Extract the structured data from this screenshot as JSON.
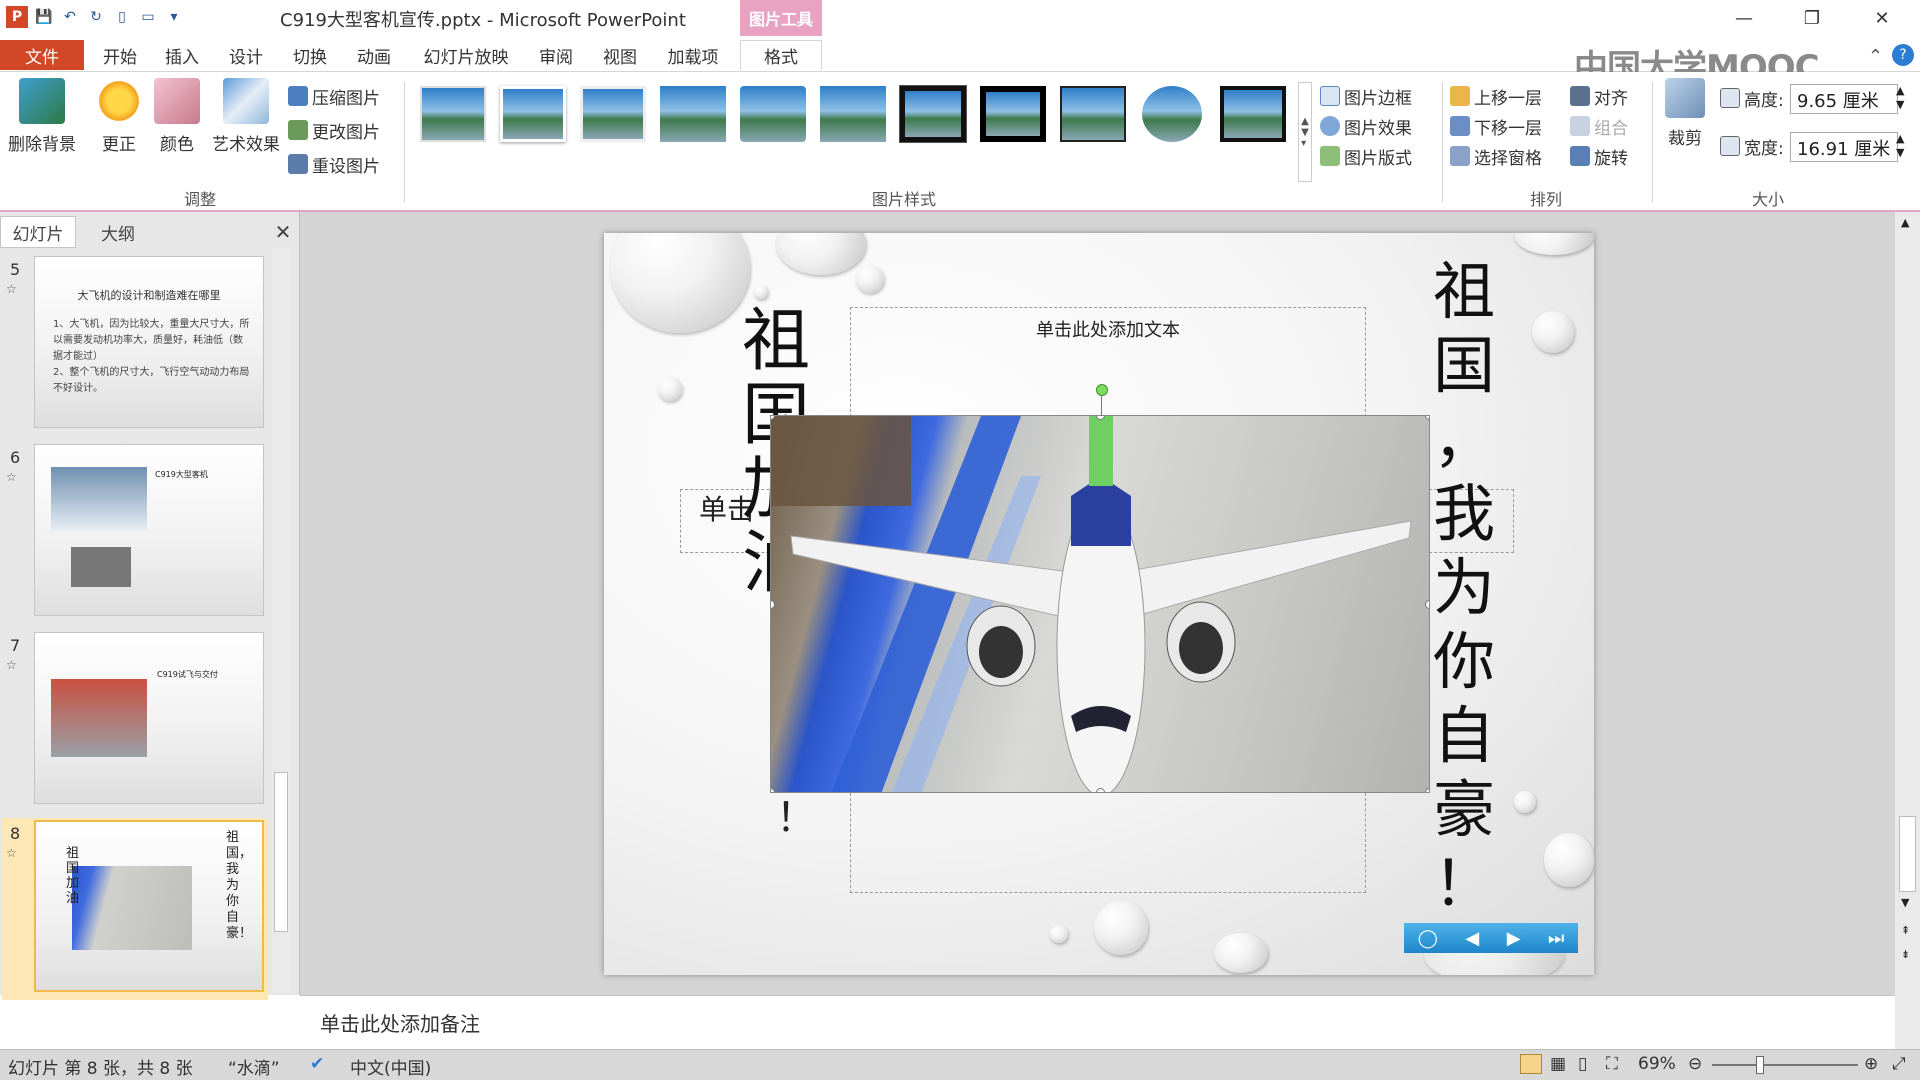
{
  "titlebar": {
    "window_title": "C919大型客机宣传.pptx - Microsoft PowerPoint",
    "context_tool": "图片工具",
    "app_icon_letter": "P"
  },
  "tabs": [
    {
      "label": "文件"
    },
    {
      "label": "开始"
    },
    {
      "label": "插入"
    },
    {
      "label": "设计"
    },
    {
      "label": "切换"
    },
    {
      "label": "动画"
    },
    {
      "label": "幻灯片放映"
    },
    {
      "label": "审阅"
    },
    {
      "label": "视图"
    },
    {
      "label": "加载项"
    },
    {
      "label": "格式"
    }
  ],
  "watermark": "中国大学MOOC",
  "ribbon": {
    "adjust": {
      "remove_bg": "删除背景",
      "correct": "更正",
      "color": "颜色",
      "art_effect": "艺术效果",
      "compress": "压缩图片",
      "change": "更改图片",
      "reset": "重设图片",
      "group_label": "调整"
    },
    "styles": {
      "border": "图片边框",
      "effect": "图片效果",
      "layout": "图片版式",
      "group_label": "图片样式"
    },
    "arrange": {
      "bring_forward": "上移一层",
      "send_backward": "下移一层",
      "selection_pane": "选择窗格",
      "align": "对齐",
      "group": "组合",
      "rotate": "旋转",
      "group_label": "排列"
    },
    "size": {
      "crop": "裁剪",
      "height_label": "高度:",
      "height_value": "9.65 厘米",
      "width_label": "宽度:",
      "width_value": "16.91 厘米",
      "group_label": "大小"
    }
  },
  "left_panel": {
    "tab_slides": "幻灯片",
    "tab_outline": "大纲",
    "slides": [
      {
        "num": "5",
        "title": "大飞机的设计和制造难在哪里",
        "text": "1、大飞机，因为比较大，重量大尺寸大，所以需要发动机功率大，质量好，耗油低（数据才能过）\n2、整个飞机的尺寸大，飞行空气动动力布局不好设计。"
      },
      {
        "num": "6",
        "title": "C919大型客机",
        "text": ""
      },
      {
        "num": "7",
        "title": "C919试飞与交付",
        "text": ""
      },
      {
        "num": "8",
        "left_text": "祖国加油",
        "right_text": "祖国，我为你自豪！"
      }
    ]
  },
  "slide": {
    "left_vertical": [
      "祖",
      "国",
      "加",
      "油"
    ],
    "right_vertical": [
      "祖",
      "国",
      "，",
      "我",
      "为",
      "你",
      "自",
      "豪",
      "！"
    ],
    "left_excl": "！",
    "placeholder_top": "单击此处添加文本",
    "placeholder_left": "单击"
  },
  "notes": {
    "placeholder": "单击此处添加备注"
  },
  "statusbar": {
    "slide_info": "幻灯片 第 8 张，共 8 张",
    "theme": "“水滴”",
    "language": "中文(中国)",
    "zoom": "69%"
  }
}
